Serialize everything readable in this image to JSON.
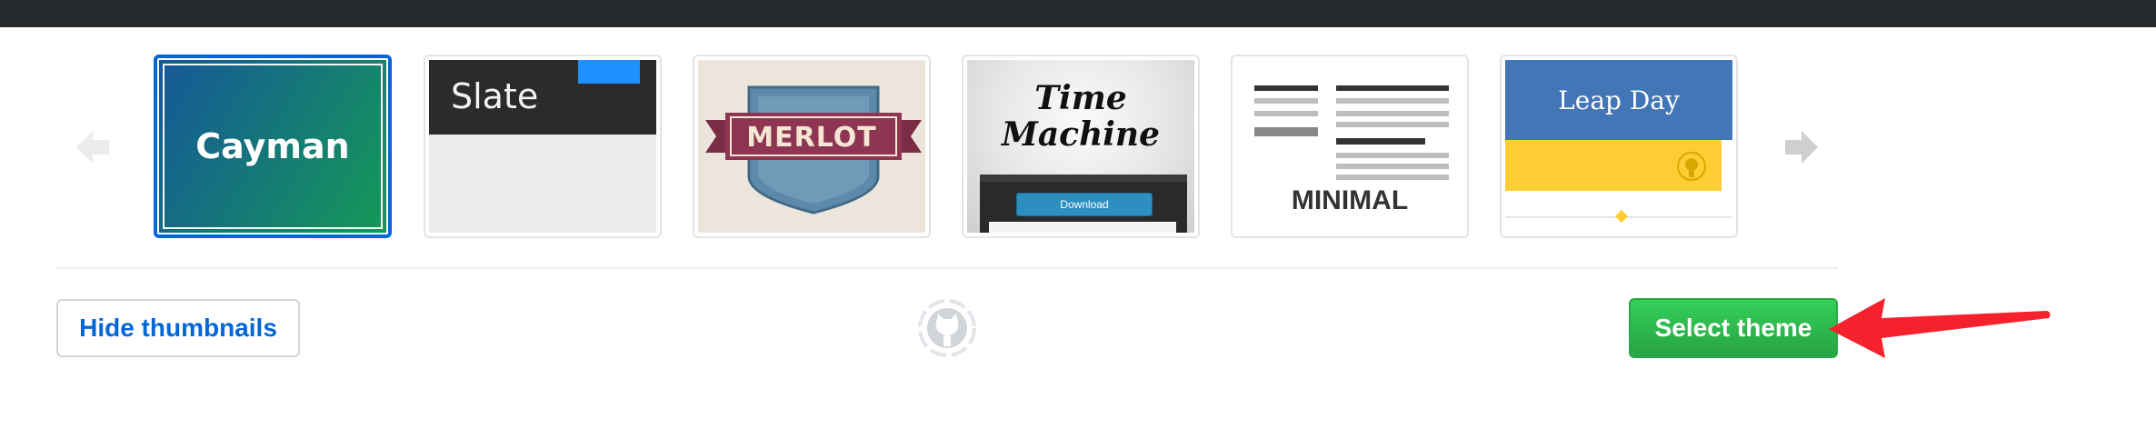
{
  "theme_chooser": {
    "themes": [
      {
        "name": "Cayman",
        "label": "Cayman",
        "selected": true
      },
      {
        "name": "Slate",
        "label": "Slate",
        "selected": false
      },
      {
        "name": "Merlot",
        "label": "MERLOT",
        "selected": false
      },
      {
        "name": "Time Machine",
        "label_line1": "Time",
        "label_line2": "Machine",
        "button_label": "Download",
        "selected": false
      },
      {
        "name": "Minimal",
        "label": "MINIMAL",
        "selected": false
      },
      {
        "name": "Leap Day",
        "label": "Leap Day",
        "selected": false
      }
    ],
    "prev_icon": "arrow-left-icon",
    "next_icon": "arrow-right-icon"
  },
  "actions": {
    "hide_thumbnails_label": "Hide thumbnails",
    "select_theme_label": "Select theme",
    "loading_icon": "octocat-spinner-icon"
  },
  "annotation": {
    "icon": "red-arrow-icon",
    "color": "#f5222d"
  },
  "colors": {
    "topbar": "#24292e",
    "link_blue": "#0366d6",
    "primary_green": "#28a745",
    "selected_border": "#0366d6"
  }
}
